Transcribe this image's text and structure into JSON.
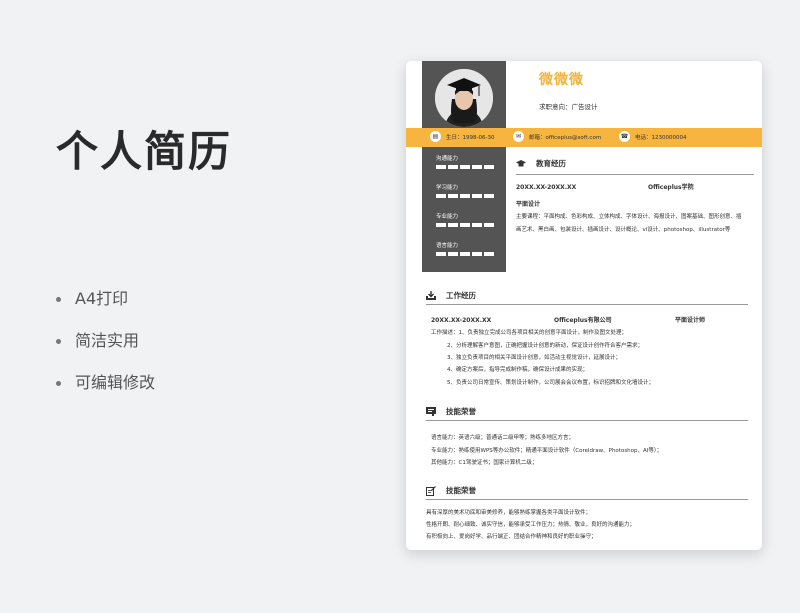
{
  "left": {
    "title": "个人简历",
    "bullets": [
      "A4打印",
      "简洁实用",
      "可编辑修改"
    ]
  },
  "resume": {
    "name": "微微微",
    "job": "求职意向：广告设计",
    "contacts": [
      {
        "icon": "calendar-icon",
        "text": "生日：1998-06-30"
      },
      {
        "icon": "mail-icon",
        "text": "邮箱：officeplus@soft.com"
      },
      {
        "icon": "phone-icon",
        "text": "电话：1230000004"
      }
    ],
    "skills": [
      {
        "label": "沟通能力",
        "level": 0.8
      },
      {
        "label": "学习能力",
        "level": 0.8
      },
      {
        "label": "专业能力",
        "level": 0.8
      },
      {
        "label": "语言能力",
        "level": 0.8
      }
    ],
    "education": {
      "heading": "教育经历",
      "date": "20XX.XX-20XX.XX",
      "school": "Officeplus学院",
      "major": "平面设计",
      "courses_1": "主要课程：平面构成、色彩构成、立体构成、字体设计、海报设计、图案基础、图形创意、插",
      "courses_2": "画艺术、黑白画、包装设计、插画设计、设计概论、vi设计、photoshop、illustrator等"
    },
    "work": {
      "heading": "工作经历",
      "date": "20XX.XX-20XX.XX",
      "company": "Officeplus有限公司",
      "position": "平面设计师",
      "lines": [
        "工作描述：1、负责独立完成公司各项目相关的创意平面设计，制作及图文处理；",
        "2、分析理解客户意图，正确把握设计创意的新动，保证设计创作符合客户需求；",
        "3、独立负责项目的相关平面设计创意，如活动主视觉设计，延展设计；",
        "4、确定方案后，指导完成制作稿，确保设计成果的实现；",
        "5、负责公司日常宣传、策划设计制作，公司展会会议布置，标识招牌和文化墙设计；"
      ]
    },
    "skills_section": {
      "heading": "技能荣誉",
      "lines": [
        "语言能力：英语六级；普通话二级甲等；熟练多地区方言；",
        "专业能力：熟练使用WPS等办公软件；精通平面设计软件（Coreldraw、Photoshop、AI等）；",
        "其他能力：C1驾驶证书；国家计算机二级；"
      ]
    },
    "self_eval": {
      "heading": "技能荣誉",
      "lines": [
        "具有深厚的美术功底和审美修养，能够熟练掌握各类平面设计软件；",
        "性格开朗、耐心细致、诚实守信，能够承受工作压力；热情、敬业，良好的沟通能力；",
        "有积极向上、爱岗好学、品行端正、团结合作精神和良好的职业操守；"
      ]
    },
    "colors": {
      "accent": "#f7b43e",
      "name": "#f2b33a",
      "sidebar": "#545454"
    }
  }
}
